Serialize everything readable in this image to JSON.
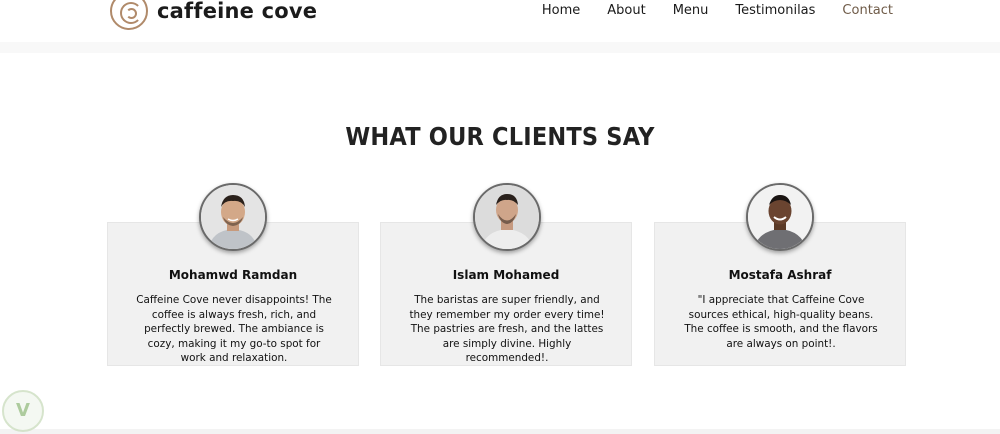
{
  "brand": {
    "name": "caffeine cove",
    "logo_icon": "coffee-swirl-icon",
    "accent_color": "#b08a6a"
  },
  "nav": {
    "items": [
      {
        "label": "Home"
      },
      {
        "label": "About"
      },
      {
        "label": "Menu"
      },
      {
        "label": "Testimonilas"
      },
      {
        "label": "Contact",
        "active": true
      }
    ],
    "active_color": "#6f5b48"
  },
  "testimonials": {
    "title": "WHAT OUR CLIENTS SAY",
    "items": [
      {
        "name": "Mohamwd Ramdan",
        "quote": "Caffeine Cove never disappoints! The coffee is always fresh, rich, and perfectly brewed. The ambiance is cozy, making it my go-to spot for work and relaxation."
      },
      {
        "name": "Islam Mohamed",
        "quote": "The baristas are super friendly, and they remember my order every time! The pastries are fresh, and the lattes are simply divine. Highly recommended!."
      },
      {
        "name": "Mostafa Ashraf",
        "quote": "\"I appreciate that Caffeine Cove sources ethical, high-quality beans. The coffee is smooth, and the flavors are always on point!."
      }
    ],
    "card_background": "#f1f1f1"
  }
}
